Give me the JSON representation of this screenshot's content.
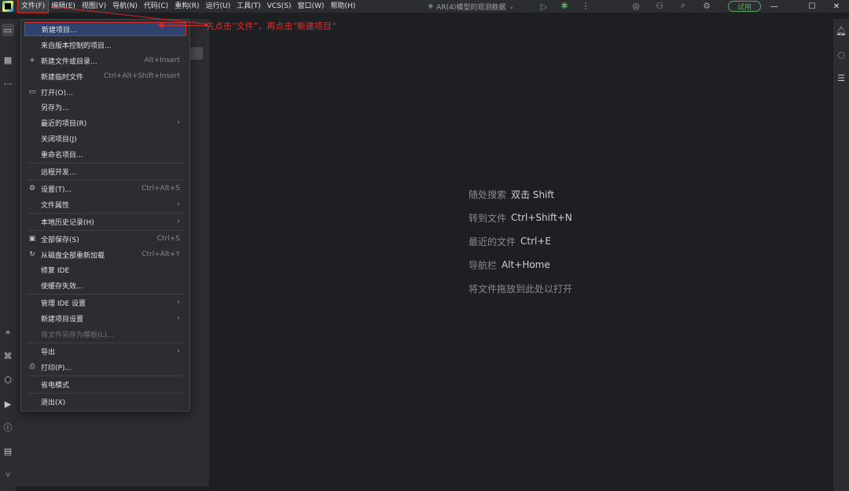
{
  "menubar": {
    "items": [
      "文件(F)",
      "编辑(E)",
      "视图(V)",
      "导航(N)",
      "代码(C)",
      "重构(R)",
      "运行(U)",
      "工具(T)",
      "VCS(S)",
      "窗口(W)",
      "帮助(H)"
    ]
  },
  "toolbar": {
    "run_config": "AR(4)模型的观测数据",
    "trial_label": "试用"
  },
  "file_menu": {
    "items": [
      {
        "label": "新建项目...",
        "shortcut": "",
        "icon": "",
        "submenu": false
      },
      {
        "label": "来自版本控制的项目...",
        "shortcut": "",
        "icon": "",
        "submenu": false
      },
      {
        "label": "新建文件或目录...",
        "shortcut": "Alt+Insert",
        "icon": "plus-icon",
        "submenu": false
      },
      {
        "label": "新建临时文件",
        "shortcut": "Ctrl+Alt+Shift+Insert",
        "icon": "",
        "submenu": false
      },
      {
        "label": "打开(O)...",
        "shortcut": "",
        "icon": "folder-icon",
        "submenu": false
      },
      {
        "label": "另存为...",
        "shortcut": "",
        "icon": "",
        "submenu": false
      },
      {
        "label": "最近的项目(R)",
        "shortcut": "",
        "icon": "",
        "submenu": true
      },
      {
        "label": "关闭项目(J)",
        "shortcut": "",
        "icon": "",
        "submenu": false
      },
      {
        "label": "重命名项目...",
        "shortcut": "",
        "icon": "",
        "submenu": false
      },
      {
        "label": "远程开发...",
        "shortcut": "",
        "icon": "",
        "submenu": false
      },
      {
        "label": "设置(T)...",
        "shortcut": "Ctrl+Alt+S",
        "icon": "gear-icon",
        "submenu": false
      },
      {
        "label": "文件属性",
        "shortcut": "",
        "icon": "",
        "submenu": true
      },
      {
        "label": "本地历史记录(H)",
        "shortcut": "",
        "icon": "",
        "submenu": true
      },
      {
        "label": "全部保存(S)",
        "shortcut": "Ctrl+S",
        "icon": "save-icon",
        "submenu": false
      },
      {
        "label": "从磁盘全部重新加载",
        "shortcut": "Ctrl+Alt+Y",
        "icon": "reload-icon",
        "submenu": false
      },
      {
        "label": "修复 IDE",
        "shortcut": "",
        "icon": "",
        "submenu": false
      },
      {
        "label": "使缓存失效...",
        "shortcut": "",
        "icon": "",
        "submenu": false
      },
      {
        "label": "管理 IDE 设置",
        "shortcut": "",
        "icon": "",
        "submenu": true
      },
      {
        "label": "新建项目设置",
        "shortcut": "",
        "icon": "",
        "submenu": true
      },
      {
        "label": "将文件另存为模板(L)...",
        "shortcut": "",
        "icon": "",
        "submenu": false
      },
      {
        "label": "导出",
        "shortcut": "",
        "icon": "",
        "submenu": true
      },
      {
        "label": "打印(P)...",
        "shortcut": "",
        "icon": "print-icon",
        "submenu": false
      },
      {
        "label": "省电模式",
        "shortcut": "",
        "icon": "",
        "submenu": false
      },
      {
        "label": "退出(X)",
        "shortcut": "",
        "icon": "",
        "submenu": false
      }
    ]
  },
  "editor_hints": [
    {
      "label": "随处搜索",
      "key": "双击 Shift"
    },
    {
      "label": "转到文件",
      "key": "Ctrl+Shift+N"
    },
    {
      "label": "最近的文件",
      "key": "Ctrl+E"
    },
    {
      "label": "导航栏",
      "key": "Alt+Home"
    },
    {
      "label": "将文件拖放到此处以打开",
      "key": ""
    }
  ],
  "annotation": {
    "text": "先点击“文件”，再点击“新建项目”"
  },
  "colors": {
    "background": "#1e1f22",
    "panel": "#2b2d30",
    "highlight": "#2e436e",
    "annotation": "#d12c2c",
    "accent_green": "#5aa85b"
  }
}
